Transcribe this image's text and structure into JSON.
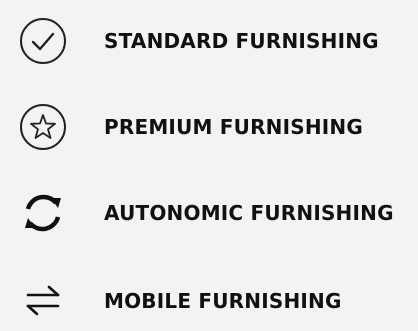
{
  "features": [
    {
      "icon": "check-circle-icon",
      "label": "STANDARD FURNISHING"
    },
    {
      "icon": "star-circle-icon",
      "label": "PREMIUM FURNISHING"
    },
    {
      "icon": "refresh-cycle-icon",
      "label": "AUTONOMIC FURNISHING"
    },
    {
      "icon": "swap-arrows-icon",
      "label": "MOBILE FURNISHING"
    }
  ],
  "colors": {
    "background": "#f3f3f3",
    "text": "#111111",
    "icon_stroke": "#222222"
  }
}
